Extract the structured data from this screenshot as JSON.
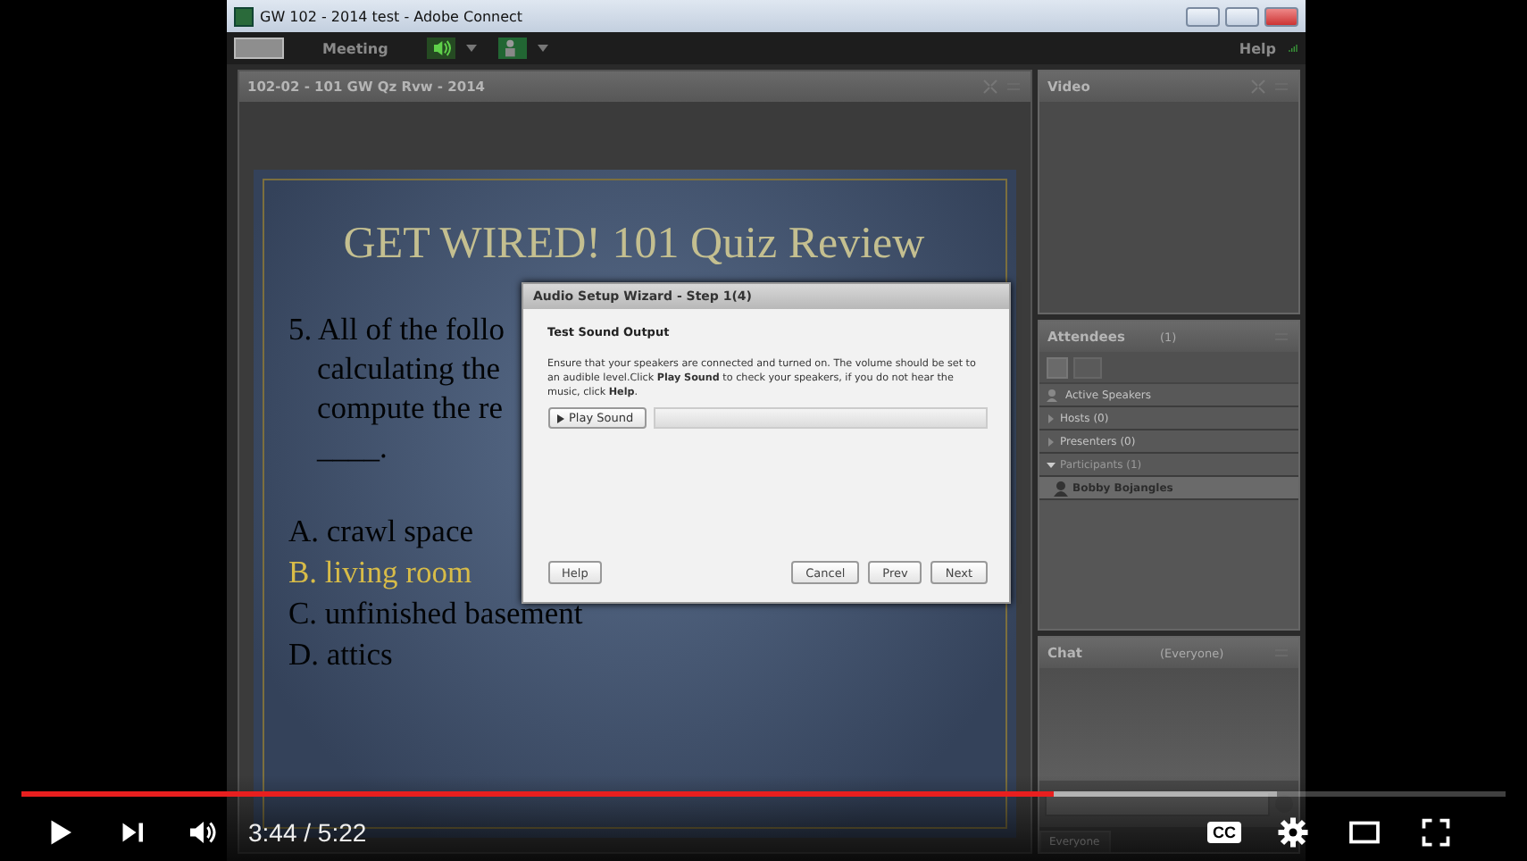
{
  "window": {
    "title": "GW 102 - 2014 test - Adobe Connect",
    "menu": [
      {
        "label": "Meeting"
      }
    ],
    "help": "Help"
  },
  "share_pod": {
    "title": "102-02 - 101 GW Qz Rvw - 2014",
    "slide": {
      "title": "GET WIRED! 101 Quiz Review",
      "question_lines": [
        "5. All of the follo",
        "calculating the",
        "compute the re"
      ],
      "blank": "____.",
      "answers": [
        {
          "text": "A. crawl space",
          "highlighted": false
        },
        {
          "text": "B. living room",
          "highlighted": true
        },
        {
          "text": "C. unfinished basement",
          "highlighted": false
        },
        {
          "text": "D. attics",
          "highlighted": false
        }
      ]
    }
  },
  "video_pod": {
    "title": "Video"
  },
  "attendees_pod": {
    "title": "Attendees",
    "count": "(1)",
    "items": [
      {
        "kind": "speakers",
        "label": "Active Speakers"
      },
      {
        "kind": "group",
        "label": "Hosts (0)",
        "expanded": false
      },
      {
        "kind": "group",
        "label": "Presenters (0)",
        "expanded": false
      },
      {
        "kind": "group",
        "label": "Participants (1)",
        "expanded": true,
        "children": [
          {
            "kind": "person",
            "label": "Bobby Bojangles",
            "selected": true
          }
        ]
      }
    ]
  },
  "chat_pod": {
    "title": "Chat",
    "scope": "(Everyone)",
    "tab": "Everyone"
  },
  "dialog": {
    "title": "Audio Setup Wizard - Step 1(4)",
    "heading": "Test Sound Output",
    "body": "Ensure that your speakers are connected and turned on. The volume should be set to an audible level.Click **Play Sound** to check your speakers, if you do not hear the music, click **Help**.",
    "play_button": "Play Sound",
    "meter": {
      "level": 0
    },
    "help_button": "Help",
    "buttons": [
      {
        "label": "Cancel"
      },
      {
        "label": "Prev"
      },
      {
        "label": "Next"
      }
    ]
  },
  "player": {
    "time": "3:44 / 5:22",
    "progress": {
      "level": 0.695
    },
    "buffer": {
      "level": 0.846
    },
    "cc_label": "CC"
  }
}
